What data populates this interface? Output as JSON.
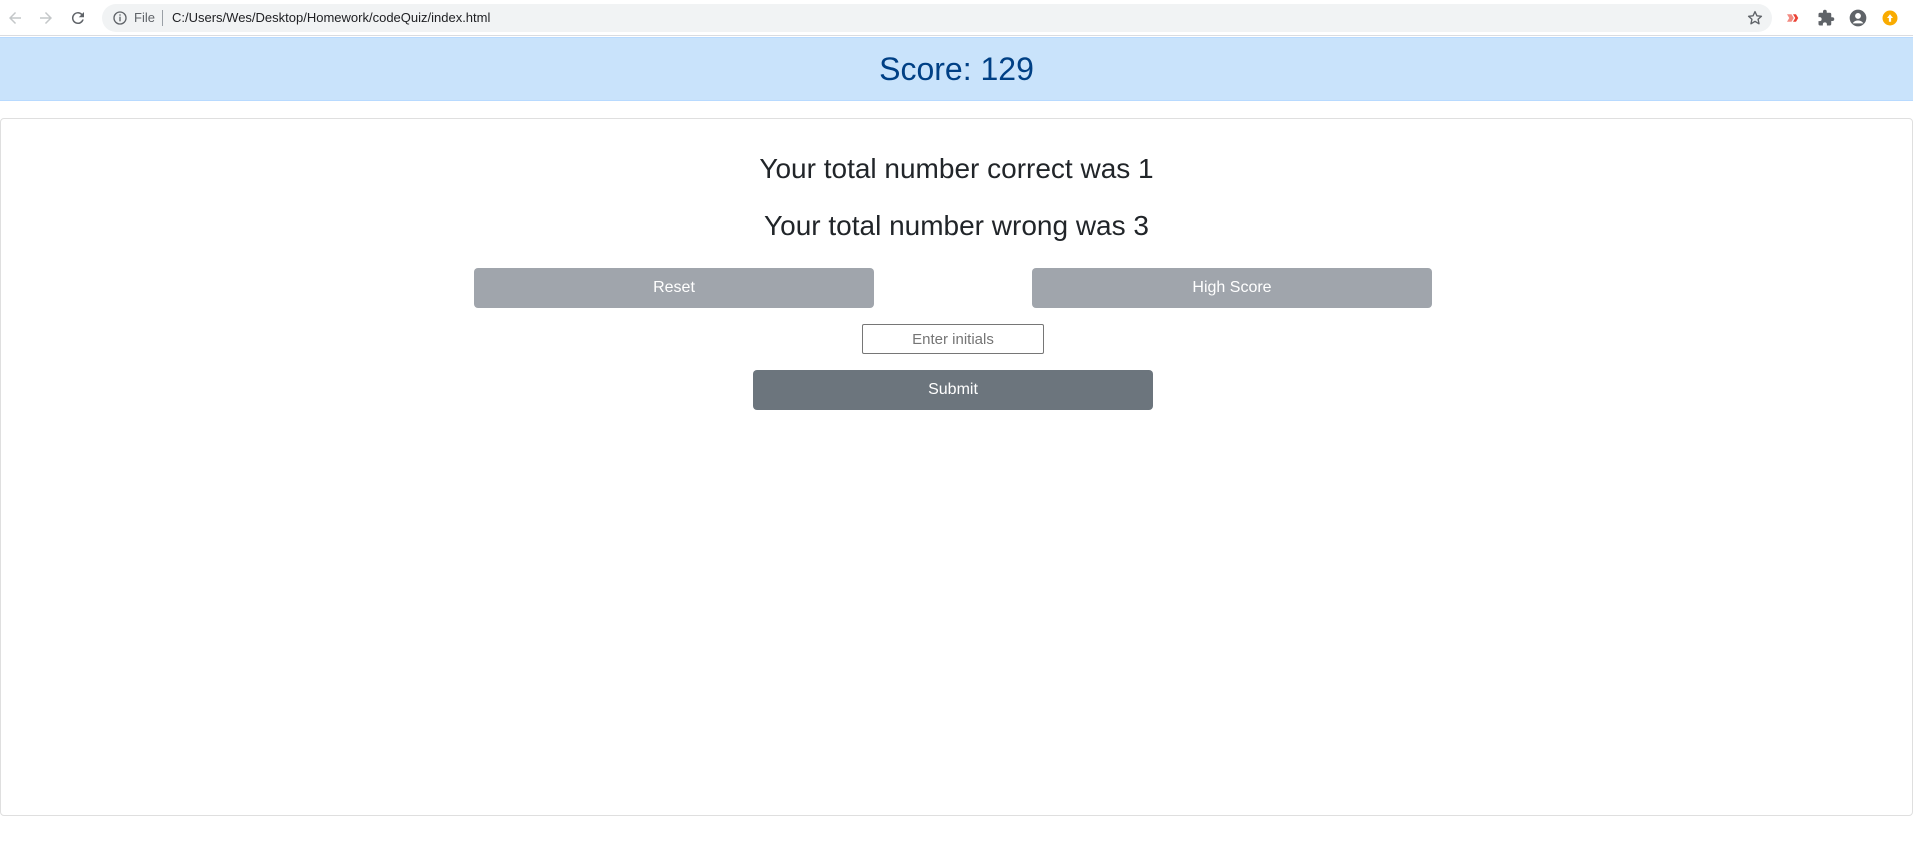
{
  "browser": {
    "address_scheme": "File",
    "address_url": "C:/Users/Wes/Desktop/Homework/codeQuiz/index.html",
    "icons": [
      "back-icon",
      "forward-icon",
      "reload-icon",
      "info-icon",
      "bookmark-star-icon",
      "extension-red-icon",
      "puzzle-icon",
      "profile-icon",
      "update-badge-icon"
    ]
  },
  "header": {
    "score_text": "Score: 129"
  },
  "results": {
    "correct_text": "Your total number correct was 1",
    "wrong_text": "Your total number wrong was 3"
  },
  "actions": {
    "reset_label": "Reset",
    "high_score_label": "High Score",
    "initials_placeholder": "Enter initials",
    "initials_value": "",
    "submit_label": "Submit"
  },
  "colors": {
    "score_bar_bg": "#c9e3fb",
    "score_text": "#004085",
    "button_light": "#a0a5ac",
    "button_dark": "#6c757d"
  }
}
